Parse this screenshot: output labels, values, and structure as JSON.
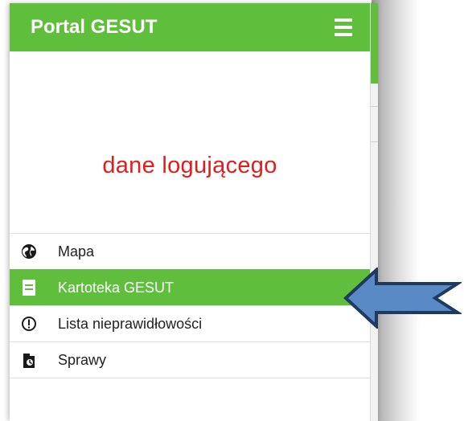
{
  "header": {
    "title": "Portal GESUT",
    "menu_icon": "hamburger-icon"
  },
  "user": {
    "label": "dane logującego",
    "label_color": "#e21b1b"
  },
  "colors": {
    "accent": "#5fbf3c",
    "arrow_fill": "#5a8ac6",
    "arrow_stroke": "#1f3a5f"
  },
  "nav": {
    "items": [
      {
        "label": "Mapa",
        "icon": "globe-icon",
        "active": false
      },
      {
        "label": "Kartoteka GESUT",
        "icon": "document-icon",
        "active": true
      },
      {
        "label": "Lista nieprawidłowości",
        "icon": "exclamation-circle-icon",
        "active": false
      },
      {
        "label": "Sprawy",
        "icon": "case-folder-icon",
        "active": false
      }
    ]
  }
}
